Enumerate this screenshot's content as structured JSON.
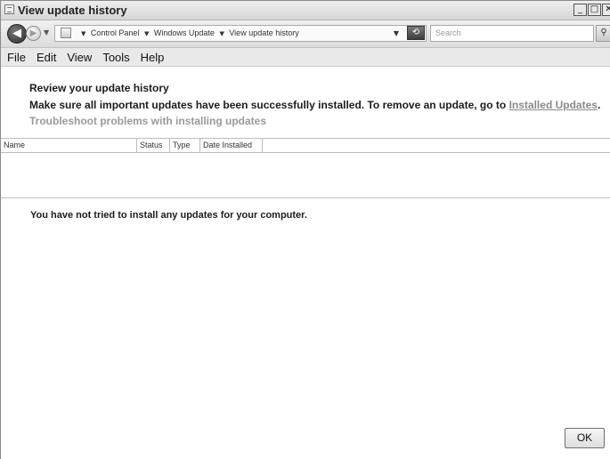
{
  "window": {
    "title": "View update history",
    "controls": {
      "minimize": "_",
      "maximize": "□",
      "close": "✕"
    }
  },
  "address_bar": {
    "back_glyph": "◀",
    "forward_glyph": "▶",
    "breadcrumbs": [
      "Control Panel",
      "Windows Update",
      "View update history"
    ],
    "search_placeholder": "Search",
    "icons": {
      "back": "back-arrow-icon",
      "forward": "forward-arrow-icon",
      "location": "control-panel-icon",
      "refresh": "refresh-icon",
      "search": "search-icon"
    }
  },
  "menu": {
    "items": [
      "File",
      "Edit",
      "View",
      "Tools",
      "Help"
    ]
  },
  "content": {
    "title": "Review your update history",
    "description_prefix": "Make sure all important updates have been successfully installed. To remove an update, go to ",
    "installed_updates_link": "Installed Updates",
    "description_suffix": ".",
    "troubleshoot_link": "Troubleshoot problems with installing updates"
  },
  "list": {
    "columns": [
      "Name",
      "Status",
      "Type",
      "Date Installed"
    ],
    "empty_message": "You have not tried to install any updates for your computer."
  },
  "footer": {
    "ok_label": "OK"
  }
}
